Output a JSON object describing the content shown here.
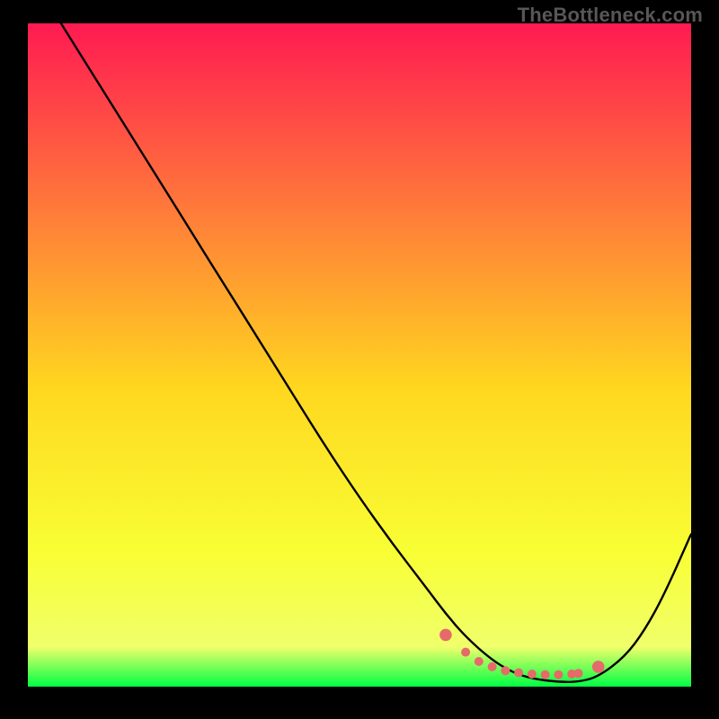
{
  "watermark": "TheBottleneck.com",
  "colors": {
    "top": "#ff1a52",
    "upper_mid": "#ff7a3a",
    "mid": "#ffd71f",
    "lower_mid": "#f8ff35",
    "near_bot": "#f0ff6b",
    "bottom": "#00ff44",
    "curve": "#000000",
    "dots": "#e66a6a"
  },
  "chart_data": {
    "type": "line",
    "title": "",
    "xlabel": "",
    "ylabel": "",
    "xlim": [
      0,
      100
    ],
    "ylim": [
      0,
      100
    ],
    "series": [
      {
        "name": "bottleneck-curve",
        "x": [
          5,
          10,
          15,
          20,
          25,
          30,
          35,
          40,
          45,
          50,
          55,
          60,
          63,
          66,
          70,
          73,
          76,
          80,
          83,
          86,
          90,
          93,
          96,
          100
        ],
        "y": [
          100,
          92,
          84,
          76,
          68,
          60,
          52,
          44,
          36,
          28.5,
          21.5,
          15,
          11,
          7.5,
          4,
          2.2,
          1.2,
          0.7,
          0.7,
          1.5,
          4.5,
          8.5,
          14,
          23
        ]
      }
    ],
    "dot_cluster": {
      "x": [
        63,
        66,
        68,
        70,
        72,
        74,
        76,
        78,
        80,
        82,
        83,
        86
      ],
      "y": [
        7.8,
        5.2,
        3.8,
        3.0,
        2.4,
        2.1,
        1.9,
        1.8,
        1.8,
        1.9,
        2.0,
        3.0
      ]
    }
  }
}
